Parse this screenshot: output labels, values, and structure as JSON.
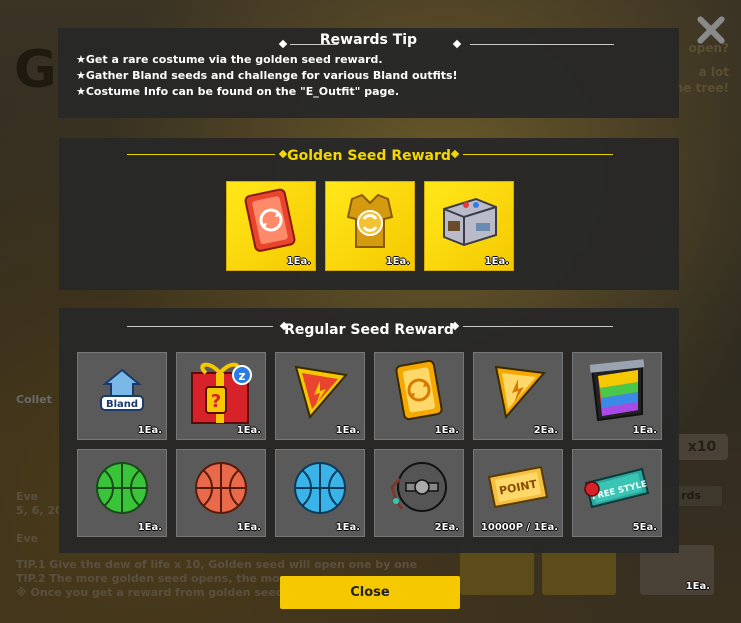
{
  "background": {
    "title_initial": "G",
    "side_text": [
      "open?",
      "a lot",
      "he tree!"
    ],
    "collect_label": "Collet",
    "tips": [
      "Eve",
      "5, 6, 20",
      "Eve",
      "TIP.1 Give the dew of life x 10, Golden seed will open one by one",
      "TIP.2 The more golden seed opens, the more...",
      "※ Once you get a reward from golden seed..."
    ],
    "x10_label": "x10",
    "cards_label": "rds",
    "tile_qty": "1Ea."
  },
  "rewards_tip": {
    "title": "Rewards Tip",
    "lines": [
      "★Get a rare costume via the golden seed reward.",
      "★Gather Bland seeds and challenge for various Bland outfits!",
      "★Costume Info can be found on the \"E_Outfit\" page."
    ]
  },
  "golden_reward": {
    "title": "Golden Seed Reward",
    "items": [
      {
        "icon": "red-refresh-card-icon",
        "qty": "1Ea."
      },
      {
        "icon": "gold-outfit-swap-icon",
        "qty": "1Ea."
      },
      {
        "icon": "machine-box-icon",
        "qty": "1Ea."
      }
    ]
  },
  "regular_reward": {
    "title": "Regular Seed Reward",
    "items": [
      {
        "icon": "bland-badge-icon",
        "qty": "1Ea."
      },
      {
        "icon": "mystery-gift-box-icon",
        "qty": "1Ea."
      },
      {
        "icon": "red-ticket-slice-icon",
        "qty": "1Ea."
      },
      {
        "icon": "gold-refresh-card-icon",
        "qty": "1Ea."
      },
      {
        "icon": "gold-ticket-slice-icon",
        "qty": "2Ea."
      },
      {
        "icon": "rainbow-pack-icon",
        "qty": "1Ea."
      },
      {
        "icon": "green-basketball-icon",
        "qty": "1Ea."
      },
      {
        "icon": "orange-basketball-icon",
        "qty": "1Ea."
      },
      {
        "icon": "blue-basketball-icon",
        "qty": "1Ea."
      },
      {
        "icon": "capsule-bomb-icon",
        "qty": "2Ea."
      },
      {
        "icon": "point-ticket-icon",
        "qty": "10000P / 1Ea.",
        "label": "POINT"
      },
      {
        "icon": "free-style-ticket-icon",
        "qty": "5Ea.",
        "label": "FREE STYLE"
      }
    ]
  },
  "close_button": {
    "label": "Close"
  },
  "colors": {
    "accent": "#f5c800",
    "panel": "#282828",
    "tile": "#5a5a5a"
  }
}
